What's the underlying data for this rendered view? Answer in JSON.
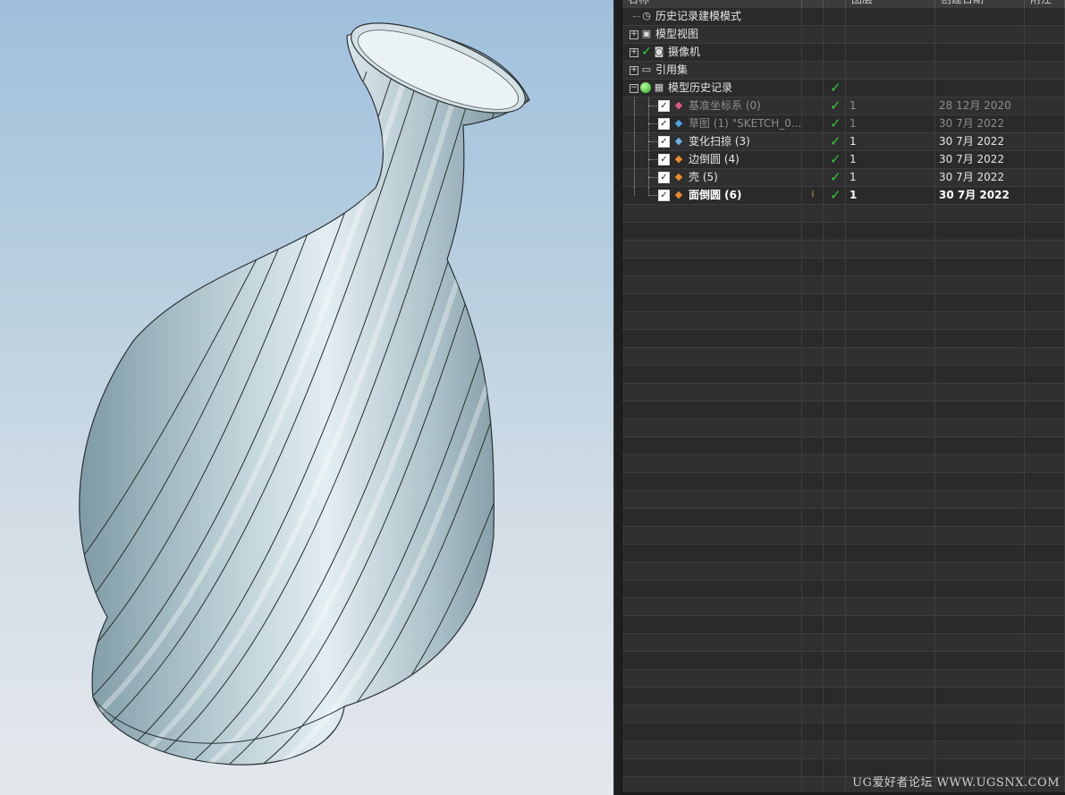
{
  "navigator": {
    "headers": {
      "name": "名称",
      "col_a": "",
      "col_b": "",
      "layer": "图层",
      "created": "创建日期",
      "more": "附注"
    },
    "nodes": {
      "history_mode": "历史记录建模模式",
      "model_views": "模型视图",
      "cameras": "摄像机",
      "reference_sets": "引用集",
      "model_history": "模型历史记录"
    },
    "features": [
      {
        "name": "基准坐标系 (0)",
        "layer": "1",
        "date": "28 12月 2020",
        "icon": "datum-csys-icon",
        "icon_color": "#e05a7a"
      },
      {
        "name": "草图 (1) \"SKETCH_0...",
        "layer": "1",
        "date": "30 7月 2022",
        "icon": "sketch-icon",
        "icon_color": "#4aa3e0"
      },
      {
        "name": "变化扫掠 (3)",
        "layer": "1",
        "date": "30 7月 2022",
        "icon": "variational-sweep-icon",
        "icon_color": "#6fb0e0"
      },
      {
        "name": "边倒圆 (4)",
        "layer": "1",
        "date": "30 7月 2022",
        "icon": "edge-blend-icon",
        "icon_color": "#f08a2a"
      },
      {
        "name": "壳 (5)",
        "layer": "1",
        "date": "30 7月 2022",
        "icon": "shell-icon",
        "icon_color": "#f08a2a"
      },
      {
        "name": "面倒圆 (6)",
        "layer": "1",
        "date": "30 7月 2022",
        "icon": "face-blend-icon",
        "icon_color": "#f08a2a"
      }
    ],
    "check_color": "#33cc33"
  },
  "watermark": "UG爱好者论坛 WWW.UGSNX.COM"
}
